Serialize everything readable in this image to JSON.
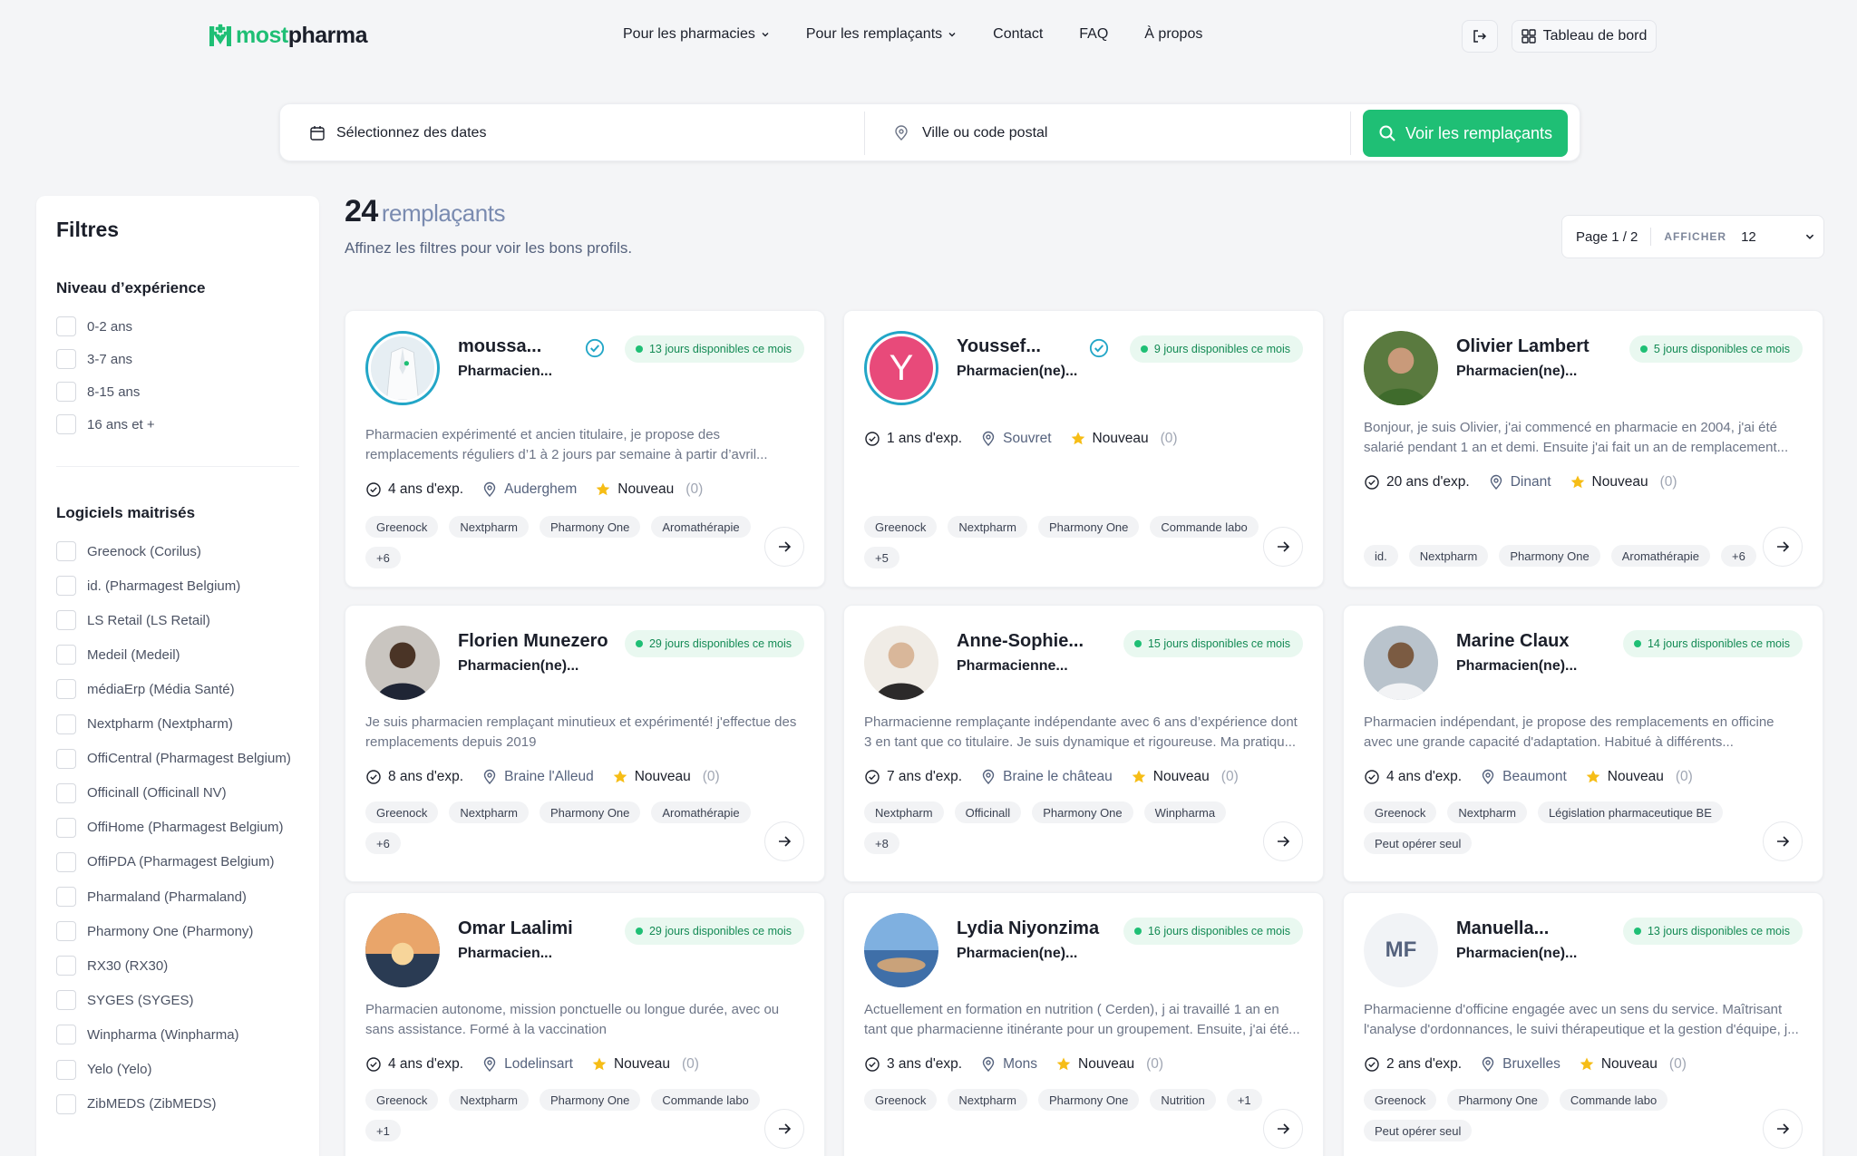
{
  "brand": {
    "most": "most",
    "pharma": "pharma",
    "accent": "#1fbf75"
  },
  "nav": {
    "pharmacies": "Pour les pharmacies",
    "remplacants": "Pour les remplaçants",
    "contact": "Contact",
    "faq": "FAQ",
    "apropos": "À propos"
  },
  "header": {
    "dashboard": "Tableau de bord",
    "logout_icon": "logout-icon"
  },
  "search": {
    "dates": "Sélectionnez des dates",
    "city": "Ville ou code postal",
    "button": "Voir les remplaçants"
  },
  "results": {
    "count": "24",
    "word": "remplaçants",
    "subtitle": "Affinez les filtres pour voir les bons profils.",
    "page": "Page 1 / 2",
    "afficher": "AFFICHER",
    "per_page": "12"
  },
  "filters": {
    "title": "Filtres",
    "experience_title": "Niveau d’expérience",
    "experience": [
      "0-2 ans",
      "3-7 ans",
      "8-15 ans",
      "16 ans et +"
    ],
    "software_title": "Logiciels maitrisés",
    "software": [
      "Greenock (Corilus)",
      "id. (Pharmagest Belgium)",
      "LS Retail (LS Retail)",
      "Medeil (Medeil)",
      "médiaErp (Média Santé)",
      "Nextpharm (Nextpharm)",
      "OffiCentral (Pharmagest Belgium)",
      "Officinall (Officinall NV)",
      "OffiHome (Pharmagest Belgium)",
      "OffiPDA (Pharmagest Belgium)",
      "Pharmaland (Pharmaland)",
      "Pharmony One (Pharmony)",
      "RX30 (RX30)",
      "SYGES (SYGES)",
      "Winpharma (Winpharma)",
      "Yelo (Yelo)",
      "ZibMEDS (ZibMEDS)"
    ]
  },
  "cards": [
    {
      "name": "moussa...",
      "role": "Pharmacien...",
      "verified": true,
      "avail": "13 jours disponibles ce mois",
      "desc": "Pharmacien expérimenté et ancien titulaire, je propose des remplacements réguliers d’1 à 2 jours par semaine à partir d’avril...",
      "exp": "4 ans d'exp.",
      "city": "Auderghem",
      "rating": "Nouveau",
      "reviews": "(0)",
      "tags": [
        "Greenock",
        "Nextpharm",
        "Pharmony One",
        "Aromathérapie",
        "+6"
      ]
    },
    {
      "name": "Youssef...",
      "role": "Pharmacien(ne)...",
      "verified": true,
      "initial": "Y",
      "avail": "9 jours disponibles ce mois",
      "desc": "",
      "exp": "1 ans d'exp.",
      "city": "Souvret",
      "rating": "Nouveau",
      "reviews": "(0)",
      "tags": [
        "Greenock",
        "Nextpharm",
        "Pharmony One",
        "Commande labo",
        "+5"
      ]
    },
    {
      "name": "Olivier Lambert",
      "role": "Pharmacien(ne)...",
      "verified": false,
      "avail": "5 jours disponibles ce mois",
      "desc": "Bonjour, je suis Olivier, j'ai commencé en pharmacie en 2004, j'ai été salarié pendant 1 an et demi. Ensuite j'ai fait un an de remplacement...",
      "exp": "20 ans d'exp.",
      "city": "Dinant",
      "rating": "Nouveau",
      "reviews": "(0)",
      "tags": [
        "id.",
        "Nextpharm",
        "Pharmony One",
        "Aromathérapie",
        "+6"
      ]
    },
    {
      "name": "Florien Munezero",
      "role": "Pharmacien(ne)...",
      "verified": false,
      "avail": "29 jours disponibles ce mois",
      "desc": "Je suis pharmacien remplaçant minutieux et expérimenté! j'effectue des remplacements depuis 2019",
      "exp": "8 ans d'exp.",
      "city": "Braine l'Alleud",
      "rating": "Nouveau",
      "reviews": "(0)",
      "tags": [
        "Greenock",
        "Nextpharm",
        "Pharmony One",
        "Aromathérapie",
        "+6"
      ]
    },
    {
      "name": "Anne-Sophie...",
      "role": "Pharmacienne...",
      "verified": false,
      "avail": "15 jours disponibles ce mois",
      "desc": "Pharmacienne remplaçante indépendante avec 6 ans d’expérience dont 3 en tant que co titulaire. Je suis dynamique et rigoureuse. Ma pratiqu...",
      "exp": "7 ans d'exp.",
      "city": "Braine le château",
      "rating": "Nouveau",
      "reviews": "(0)",
      "tags": [
        "Nextpharm",
        "Officinall",
        "Pharmony One",
        "Winpharma",
        "+8"
      ]
    },
    {
      "name": "Marine Claux",
      "role": "Pharmacien(ne)...",
      "verified": false,
      "avail": "14 jours disponibles ce mois",
      "desc": "Pharmacien indépendant, je propose des remplacements en officine avec une grande capacité d'adaptation. Habitué à différents...",
      "exp": "4 ans d'exp.",
      "city": "Beaumont",
      "rating": "Nouveau",
      "reviews": "(0)",
      "tags": [
        "Greenock",
        "Nextpharm",
        "Législation pharmaceutique BE",
        "Peut opérer seul"
      ]
    },
    {
      "name": "Omar Laalimi",
      "role": "Pharmacien...",
      "verified": false,
      "avail": "29 jours disponibles ce mois",
      "desc": "Pharmacien autonome, mission ponctuelle ou longue durée, avec ou sans assistance. Formé à la vaccination",
      "exp": "4 ans d'exp.",
      "city": "Lodelinsart",
      "rating": "Nouveau",
      "reviews": "(0)",
      "tags": [
        "Greenock",
        "Nextpharm",
        "Pharmony One",
        "Commande labo",
        "+1"
      ]
    },
    {
      "name": "Lydia Niyonzima",
      "role": "Pharmacien(ne)...",
      "verified": false,
      "avail": "16 jours disponibles ce mois",
      "desc": "Actuellement en formation en nutrition ( Cerden), j ai travaillé 1 an en tant que pharmacienne itinérante pour un groupement. Ensuite, j'ai été...",
      "exp": "3 ans d'exp.",
      "city": "Mons",
      "rating": "Nouveau",
      "reviews": "(0)",
      "tags": [
        "Greenock",
        "Nextpharm",
        "Pharmony One",
        "Nutrition",
        "+1"
      ]
    },
    {
      "name": "Manuella...",
      "role": "Pharmacien(ne)...",
      "verified": false,
      "initial": "MF",
      "avail": "13 jours disponibles ce mois",
      "desc": "Pharmacienne d'officine engagée avec un sens du service. Maîtrisant l'analyse d'ordonnances, le suivi thérapeutique et la gestion d'équipe, j...",
      "exp": "2 ans d'exp.",
      "city": "Bruxelles",
      "rating": "Nouveau",
      "reviews": "(0)",
      "tags": [
        "Greenock",
        "Pharmony One",
        "Commande labo",
        "Peut opérer seul"
      ]
    }
  ]
}
